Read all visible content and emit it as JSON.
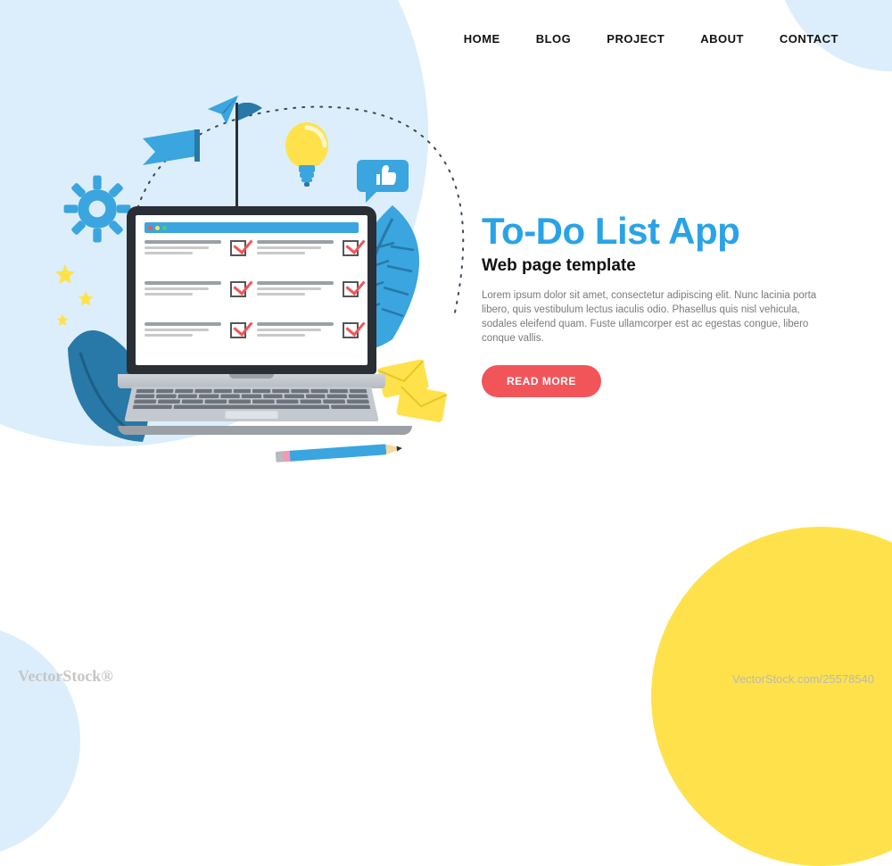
{
  "nav": {
    "items": [
      "HOME",
      "BLOG",
      "PROJECT",
      "ABOUT",
      "CONTACT"
    ]
  },
  "hero": {
    "title": "To-Do List App",
    "subtitle": "Web page template",
    "body": "Lorem ipsum dolor sit amet, consectetur adipiscing elit. Nunc lacinia porta libero, quis vestibulum lectus iaculis odio. Phasellus quis nisl vehicula, sodales eleifend quam. Fuste ullamcorper est ac egestas congue, libero conque vallis.",
    "cta": "READ MORE"
  },
  "watermark": "VectorStock®",
  "imageId": "VectorStock.com/25578540"
}
